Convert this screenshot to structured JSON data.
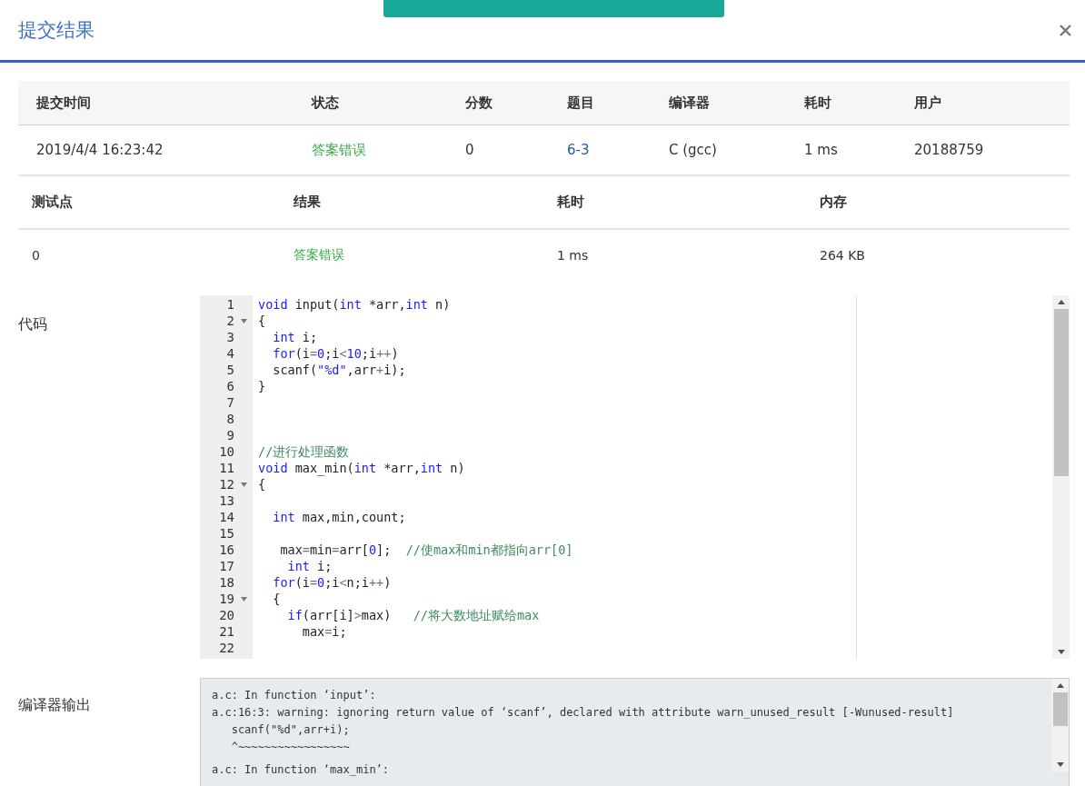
{
  "toast": {
    "kind": "success"
  },
  "dialog": {
    "title": "提交结果"
  },
  "summary": {
    "columns": [
      "提交时间",
      "状态",
      "分数",
      "题目",
      "编译器",
      "耗时",
      "用户"
    ],
    "row": [
      {
        "kind": "text",
        "text": "2019/4/4 16:23:42"
      },
      {
        "kind": "status",
        "text": "答案错误"
      },
      {
        "kind": "text",
        "text": "0"
      },
      {
        "kind": "link",
        "text": "6-3"
      },
      {
        "kind": "text",
        "text": "C (gcc)"
      },
      {
        "kind": "text",
        "text": "1 ms"
      },
      {
        "kind": "text",
        "text": "20188759"
      }
    ]
  },
  "tests": {
    "columns": [
      "测试点",
      "结果",
      "耗时",
      "内存"
    ],
    "rows": [
      [
        {
          "kind": "text",
          "text": "0"
        },
        {
          "kind": "status",
          "text": "答案错误"
        },
        {
          "kind": "text",
          "text": "1 ms"
        },
        {
          "kind": "text",
          "text": "264 KB"
        }
      ]
    ]
  },
  "code": {
    "label": "代码",
    "lines": [
      {
        "number": "1",
        "foldable": false,
        "tokens": [
          {
            "kind": "kw",
            "text": "void"
          },
          {
            "kind": "plain",
            "text": " input("
          },
          {
            "kind": "kw",
            "text": "int"
          },
          {
            "kind": "plain",
            "text": " *arr,"
          },
          {
            "kind": "kw",
            "text": "int"
          },
          {
            "kind": "plain",
            "text": " n)"
          }
        ]
      },
      {
        "number": "2",
        "foldable": true,
        "tokens": [
          {
            "kind": "plain",
            "text": "{"
          }
        ]
      },
      {
        "number": "3",
        "foldable": false,
        "tokens": [
          {
            "kind": "kw",
            "text": "  int"
          },
          {
            "kind": "plain",
            "text": " i;"
          }
        ]
      },
      {
        "number": "4",
        "foldable": false,
        "tokens": [
          {
            "kind": "kw",
            "text": "  for"
          },
          {
            "kind": "plain",
            "text": "(i"
          },
          {
            "kind": "op",
            "text": "="
          },
          {
            "kind": "num",
            "text": "0"
          },
          {
            "kind": "plain",
            "text": ";i"
          },
          {
            "kind": "op",
            "text": "<"
          },
          {
            "kind": "num",
            "text": "10"
          },
          {
            "kind": "plain",
            "text": ";i"
          },
          {
            "kind": "op",
            "text": "++"
          },
          {
            "kind": "plain",
            "text": ")"
          }
        ]
      },
      {
        "number": "5",
        "foldable": false,
        "tokens": [
          {
            "kind": "plain",
            "text": "  scanf("
          },
          {
            "kind": "str",
            "text": "\"%d\""
          },
          {
            "kind": "plain",
            "text": ",arr"
          },
          {
            "kind": "op",
            "text": "+"
          },
          {
            "kind": "plain",
            "text": "i);"
          }
        ]
      },
      {
        "number": "6",
        "foldable": false,
        "tokens": [
          {
            "kind": "plain",
            "text": "}"
          }
        ]
      },
      {
        "number": "7",
        "foldable": false
      },
      {
        "number": "8",
        "foldable": false
      },
      {
        "number": "9",
        "foldable": false
      },
      {
        "number": "10",
        "foldable": false,
        "tokens": [
          {
            "kind": "cmt",
            "text": "//进行处理函数"
          }
        ]
      },
      {
        "number": "11",
        "foldable": false,
        "tokens": [
          {
            "kind": "kw",
            "text": "void"
          },
          {
            "kind": "plain",
            "text": " max_min("
          },
          {
            "kind": "kw",
            "text": "int"
          },
          {
            "kind": "plain",
            "text": " *arr,"
          },
          {
            "kind": "kw",
            "text": "int"
          },
          {
            "kind": "plain",
            "text": " n)"
          }
        ]
      },
      {
        "number": "12",
        "foldable": true,
        "tokens": [
          {
            "kind": "plain",
            "text": "{"
          }
        ]
      },
      {
        "number": "13",
        "foldable": false
      },
      {
        "number": "14",
        "foldable": false,
        "tokens": [
          {
            "kind": "kw",
            "text": "  int"
          },
          {
            "kind": "plain",
            "text": " max,min,count;"
          }
        ]
      },
      {
        "number": "15",
        "foldable": false
      },
      {
        "number": "16",
        "foldable": false,
        "tokens": [
          {
            "kind": "plain",
            "text": "   max"
          },
          {
            "kind": "op",
            "text": "="
          },
          {
            "kind": "plain",
            "text": "min"
          },
          {
            "kind": "op",
            "text": "="
          },
          {
            "kind": "plain",
            "text": "arr["
          },
          {
            "kind": "num",
            "text": "0"
          },
          {
            "kind": "plain",
            "text": "];  "
          },
          {
            "kind": "cmt",
            "text": "//使max和min都指向arr[0]"
          }
        ]
      },
      {
        "number": "17",
        "foldable": false,
        "tokens": [
          {
            "kind": "kw",
            "text": "    int"
          },
          {
            "kind": "plain",
            "text": " i;"
          }
        ]
      },
      {
        "number": "18",
        "foldable": false,
        "tokens": [
          {
            "kind": "kw",
            "text": "  for"
          },
          {
            "kind": "plain",
            "text": "(i"
          },
          {
            "kind": "op",
            "text": "="
          },
          {
            "kind": "num",
            "text": "0"
          },
          {
            "kind": "plain",
            "text": ";i"
          },
          {
            "kind": "op",
            "text": "<"
          },
          {
            "kind": "plain",
            "text": "n;i"
          },
          {
            "kind": "op",
            "text": "++"
          },
          {
            "kind": "plain",
            "text": ")"
          }
        ]
      },
      {
        "number": "19",
        "foldable": true,
        "tokens": [
          {
            "kind": "plain",
            "text": "  {"
          }
        ]
      },
      {
        "number": "20",
        "foldable": false,
        "tokens": [
          {
            "kind": "kw",
            "text": "    if"
          },
          {
            "kind": "plain",
            "text": "(arr[i]"
          },
          {
            "kind": "op",
            "text": ">"
          },
          {
            "kind": "plain",
            "text": "max)   "
          },
          {
            "kind": "cmt",
            "text": "//将大数地址赋给max"
          }
        ]
      },
      {
        "number": "21",
        "foldable": false,
        "tokens": [
          {
            "kind": "plain",
            "text": "      max"
          },
          {
            "kind": "op",
            "text": "="
          },
          {
            "kind": "plain",
            "text": "i;"
          }
        ]
      },
      {
        "number": "22",
        "foldable": false
      }
    ]
  },
  "compiler_output": {
    "label": "编译器输出",
    "groups": [
      [
        "a.c: In function ‘input’:",
        "a.c:16:3: warning: ignoring return value of ‘scanf’, declared with attribute warn_unused_result [-Wunused-result]",
        "   scanf(\"%d\",arr+i);",
        "   ^~~~~~~~~~~~~~~~~~"
      ],
      [
        "a.c: In function ‘max_min’:"
      ]
    ]
  }
}
